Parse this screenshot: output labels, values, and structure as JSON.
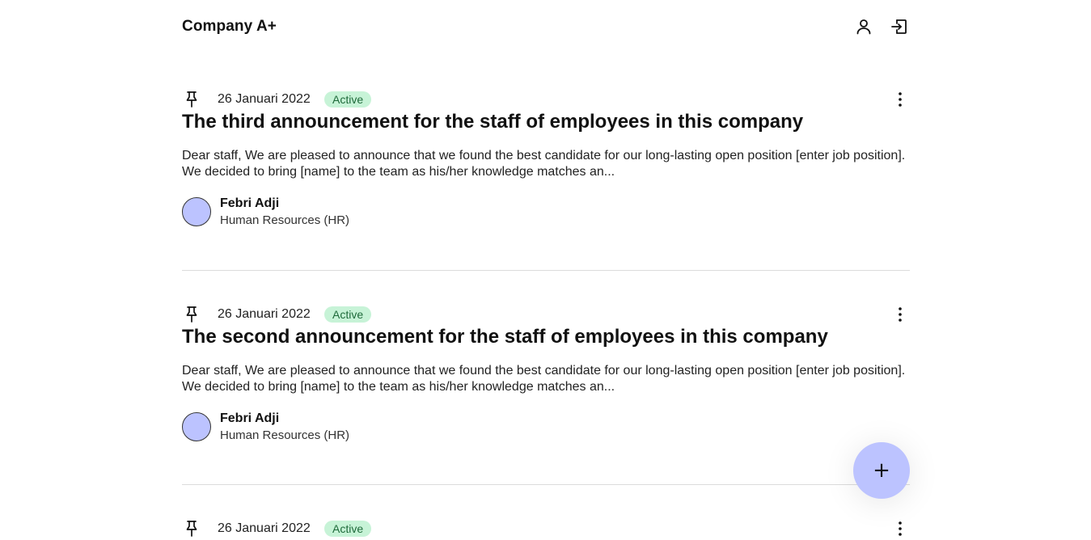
{
  "header": {
    "brand": "Company A+",
    "profile_icon": "user-icon",
    "logout_icon": "logout-icon"
  },
  "posts": [
    {
      "date": "26 Januari 2022",
      "status": "Active",
      "title": "The third announcement for the staff of employees in this company",
      "excerpt": "Dear staff, We are pleased to announce that we found the best candidate for our long-lasting open position [enter job position]. We decided to bring [name] to the team as his/her knowledge matches an...",
      "author_name": "Febri Adji",
      "author_role": "Human Resources (HR)"
    },
    {
      "date": "26 Januari 2022",
      "status": "Active",
      "title": "The second announcement for the staff of employees in this company",
      "excerpt": "Dear staff, We are pleased to announce that we found the best candidate for our long-lasting open position [enter job position]. We decided to bring [name] to the team as his/her knowledge matches an...",
      "author_name": "Febri Adji",
      "author_role": "Human Resources (HR)"
    },
    {
      "date": "26 Januari 2022",
      "status": "Active"
    }
  ],
  "fab": {
    "label": "+",
    "icon": "plus-icon"
  },
  "colors": {
    "badge_bg": "#c7f3d7",
    "badge_text": "#1f6b3b",
    "avatar": "#bcc3ff",
    "fab": "#bcc3ff"
  }
}
